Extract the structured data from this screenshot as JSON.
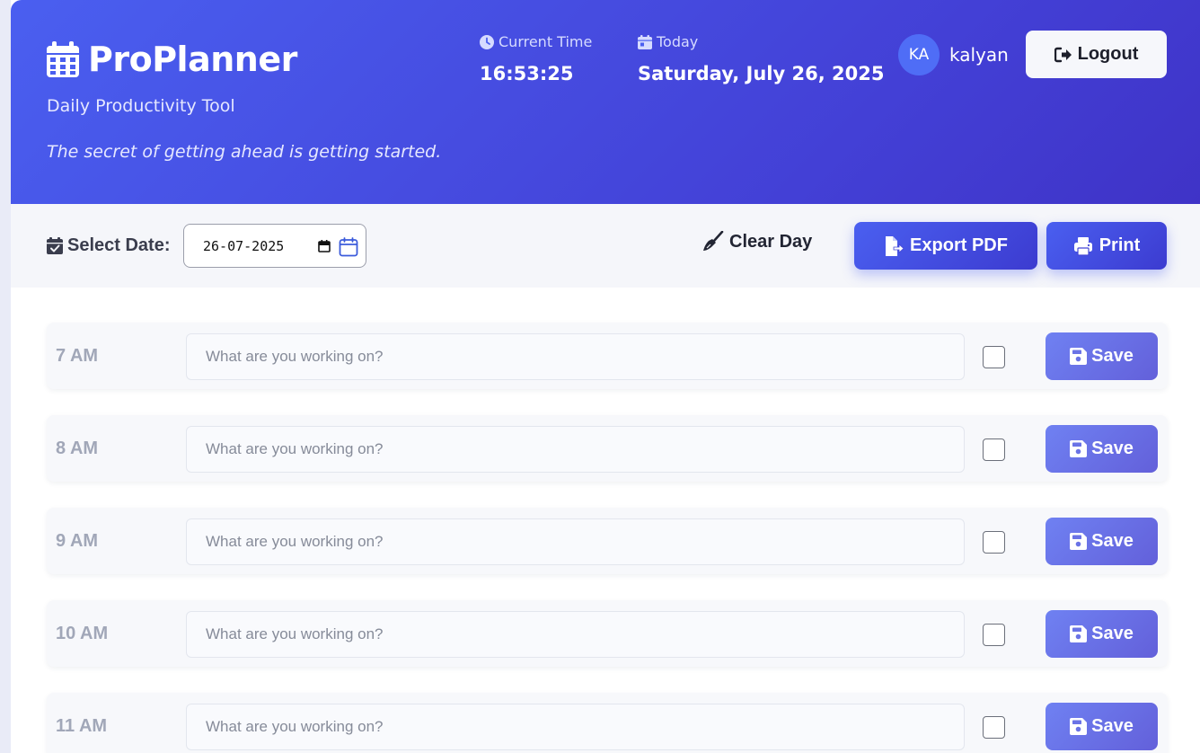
{
  "header": {
    "brand_title": "ProPlanner",
    "subtitle": "Daily Productivity Tool",
    "quote": "The secret of getting ahead is getting started.",
    "current_time_label": "Current Time",
    "current_time_value": "16:53:25",
    "today_label": "Today",
    "today_value": "Saturday, July 26, 2025",
    "user_initials": "KA",
    "username": "kalyan",
    "logout_label": "Logout"
  },
  "toolbar": {
    "select_date_label": "Select Date:",
    "date_value": "26-07-2025",
    "clear_day_label": "Clear Day",
    "export_pdf_label": "Export PDF",
    "print_label": "Print"
  },
  "slots": [
    {
      "time": "7 AM",
      "placeholder": "What are you working on?",
      "value": "",
      "done": false,
      "save_label": "Save"
    },
    {
      "time": "8 AM",
      "placeholder": "What are you working on?",
      "value": "",
      "done": false,
      "save_label": "Save"
    },
    {
      "time": "9 AM",
      "placeholder": "What are you working on?",
      "value": "",
      "done": false,
      "save_label": "Save"
    },
    {
      "time": "10 AM",
      "placeholder": "What are you working on?",
      "value": "",
      "done": false,
      "save_label": "Save"
    },
    {
      "time": "11 AM",
      "placeholder": "What are you working on?",
      "value": "",
      "done": false,
      "save_label": "Save"
    }
  ],
  "colors": {
    "header_gradient_start": "#4a5ff0",
    "header_gradient_end": "#3f33c7",
    "button_primary": "#4a5ff0",
    "save_button": "#6f81f2",
    "avatar": "#4f6df6"
  },
  "icons": {
    "brand": "calendar-icon",
    "current_time": "clock-icon",
    "today": "calendar-day-icon",
    "logout": "sign-out-icon",
    "select_date": "calendar-check-icon",
    "date_picker": "calendar-picker-icon",
    "clear_day": "broom-icon",
    "export_pdf": "file-export-icon",
    "print": "printer-icon",
    "save": "floppy-disk-icon"
  }
}
